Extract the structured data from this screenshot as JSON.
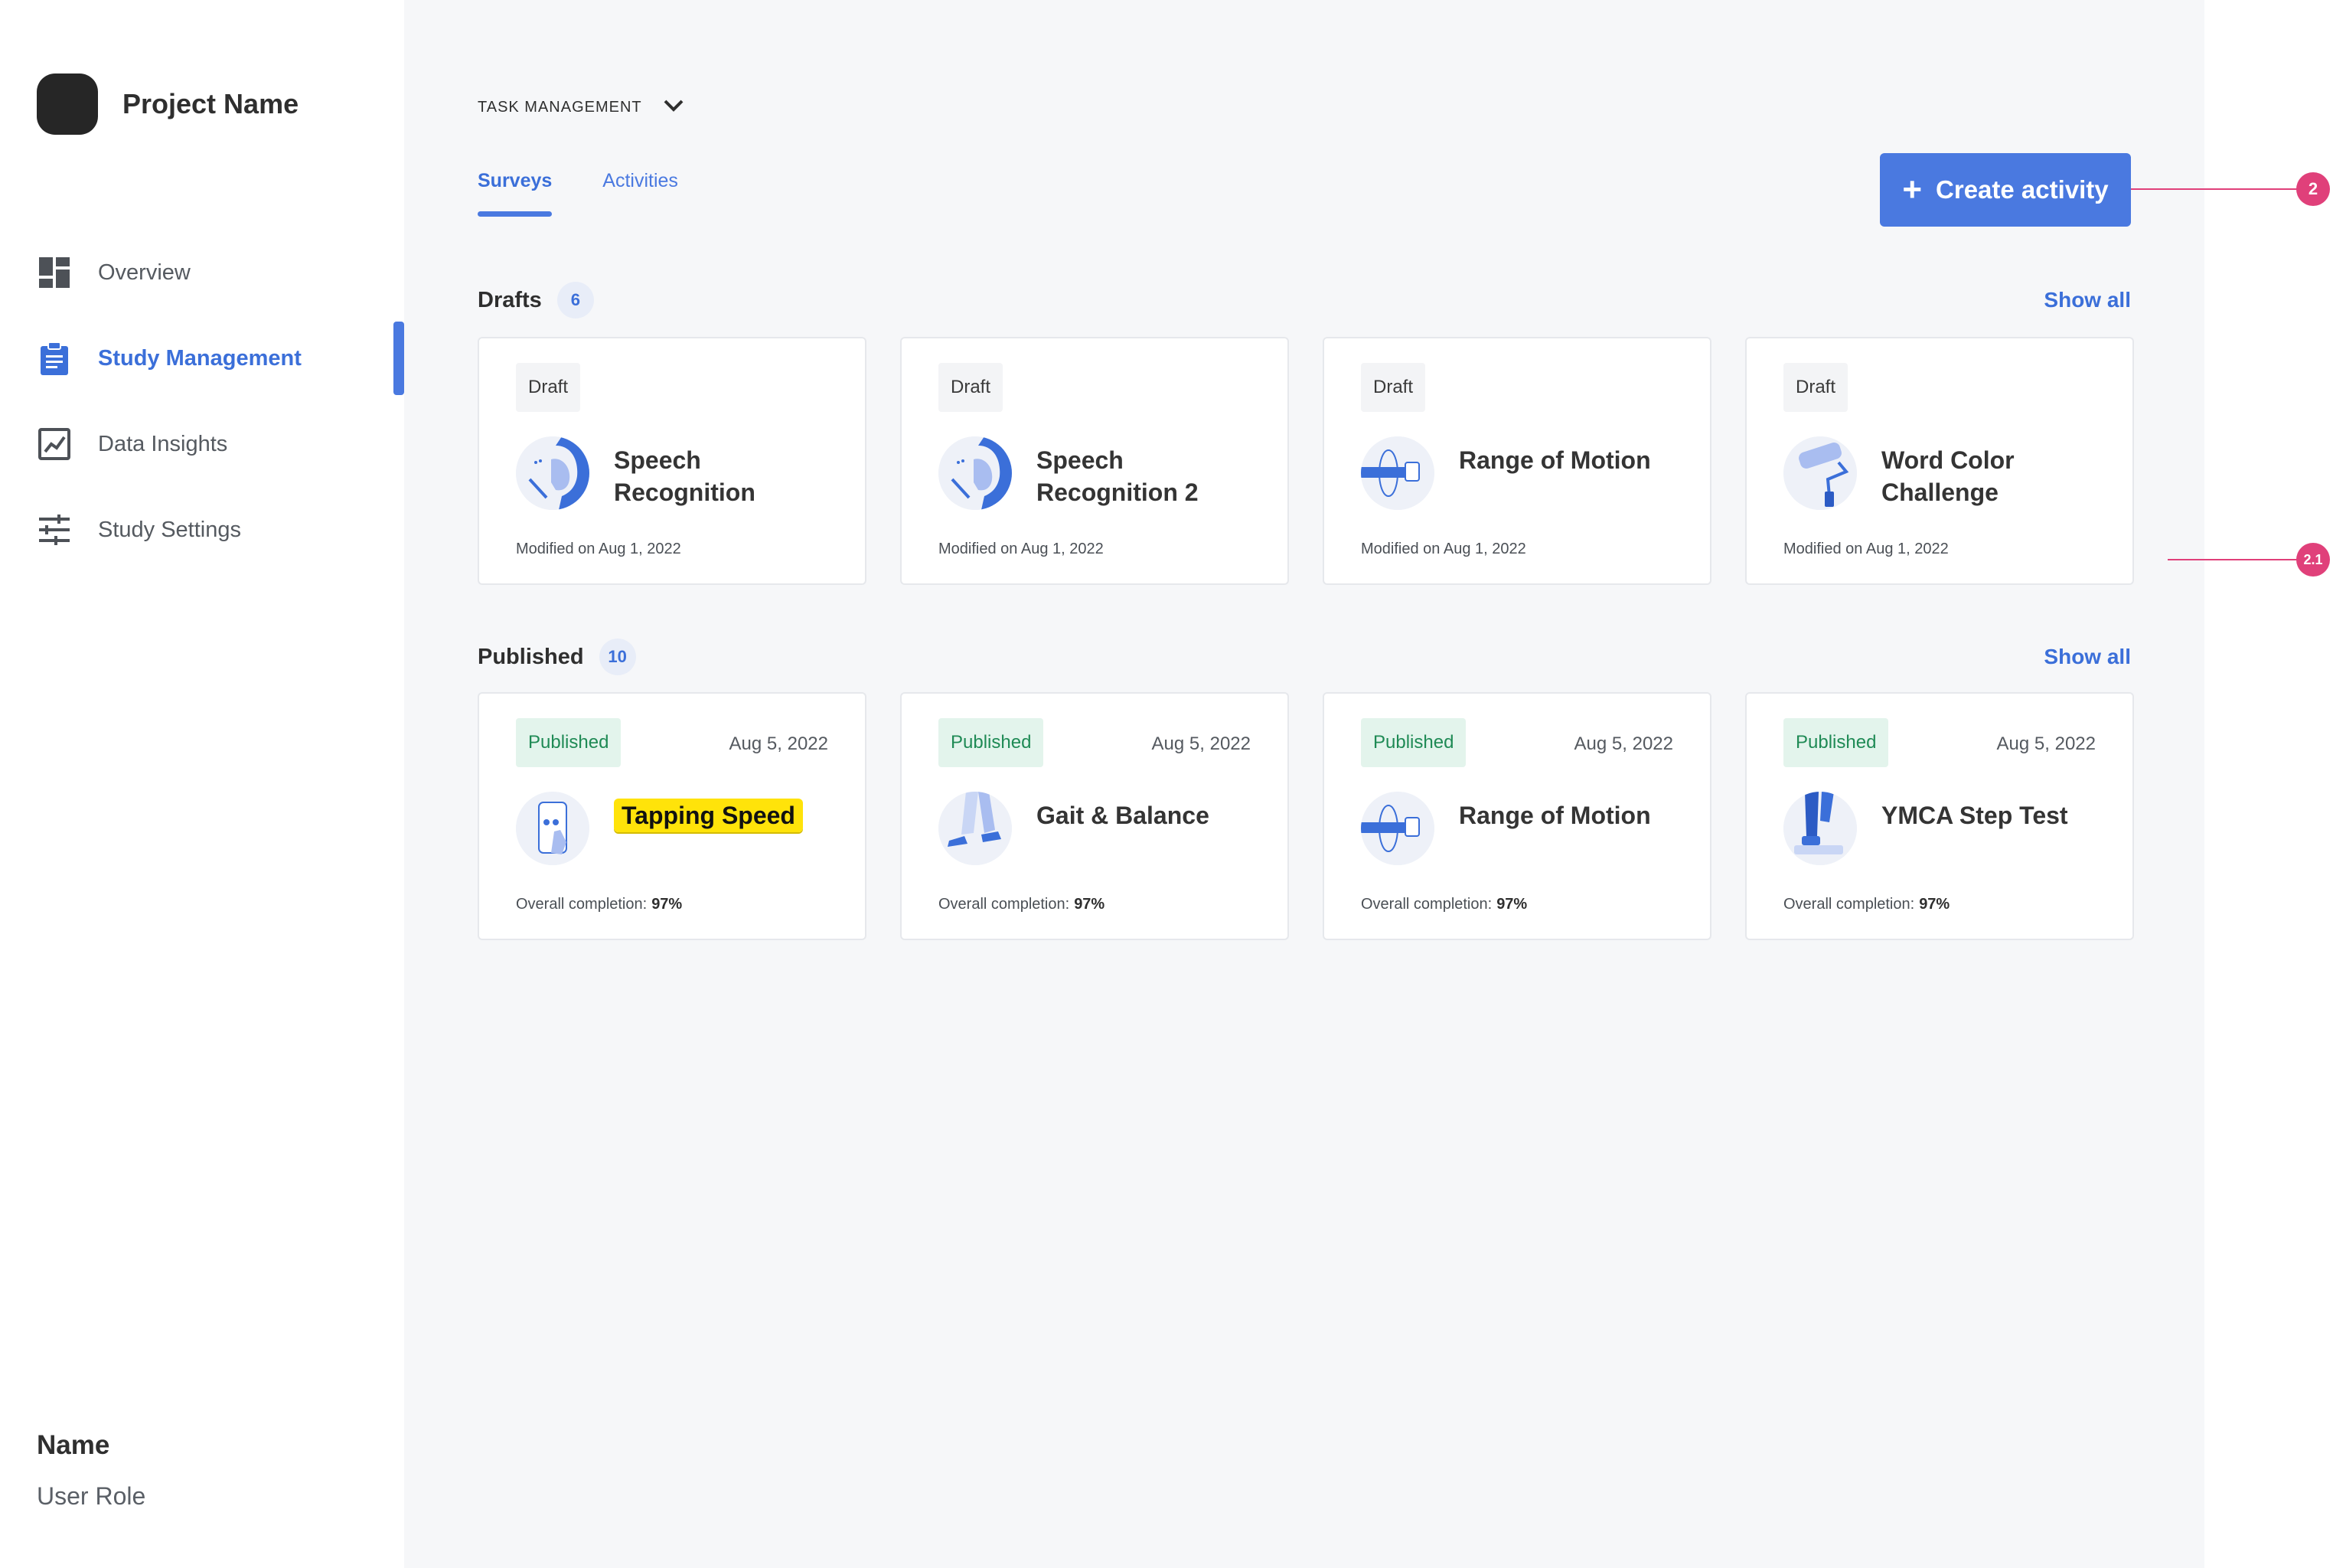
{
  "sidebar": {
    "project_name": "Project Name",
    "items": [
      {
        "label": "Overview",
        "icon": "dashboard-icon"
      },
      {
        "label": "Study Management",
        "icon": "clipboard-icon",
        "active": true
      },
      {
        "label": "Data Insights",
        "icon": "chart-icon"
      },
      {
        "label": "Study Settings",
        "icon": "sliders-icon"
      }
    ],
    "user": {
      "name": "Name",
      "role": "User Role"
    }
  },
  "header": {
    "breadcrumb": "TASK MANAGEMENT",
    "tabs": [
      {
        "label": "Surveys",
        "active": true
      },
      {
        "label": "Activities",
        "active": false
      }
    ],
    "create_button": "Create activity"
  },
  "drafts": {
    "title": "Drafts",
    "count": "6",
    "show_all": "Show all",
    "cards": [
      {
        "status": "Draft",
        "title": "Speech Recognition",
        "icon": "speech-icon",
        "meta": "Modified on Aug 1, 2022"
      },
      {
        "status": "Draft",
        "title": "Speech Recognition 2",
        "icon": "speech-icon",
        "meta": "Modified on Aug 1, 2022"
      },
      {
        "status": "Draft",
        "title": "Range of Motion",
        "icon": "range-of-motion-icon",
        "meta": "Modified on Aug 1, 2022"
      },
      {
        "status": "Draft",
        "title": "Word Color Challenge",
        "icon": "paint-roller-icon",
        "meta": "Modified on Aug 1, 2022"
      }
    ]
  },
  "published": {
    "title": "Published",
    "count": "10",
    "show_all": "Show all",
    "cards": [
      {
        "status": "Published",
        "date": "Aug 5, 2022",
        "title": "Tapping Speed",
        "icon": "tapping-phone-icon",
        "meta_label": "Overall completion:",
        "meta_value": "97%"
      },
      {
        "status": "Published",
        "date": "Aug 5, 2022",
        "title": "Gait & Balance",
        "icon": "walking-legs-icon",
        "meta_label": "Overall completion:",
        "meta_value": "97%"
      },
      {
        "status": "Published",
        "date": "Aug 5, 2022",
        "title": "Range of Motion",
        "icon": "range-of-motion-icon",
        "meta_label": "Overall completion:",
        "meta_value": "97%"
      },
      {
        "status": "Published",
        "date": "Aug 5, 2022",
        "title": "YMCA Step Test",
        "icon": "step-test-icon",
        "meta_label": "Overall completion:",
        "meta_value": "97%"
      }
    ]
  },
  "annotations": [
    "2",
    "2.1"
  ],
  "colors": {
    "accent": "#4a79e0",
    "published_bg": "#e3f4ec",
    "published_text": "#1f8a55",
    "highlight": "#ffe30a",
    "annotation": "#e0407a"
  }
}
